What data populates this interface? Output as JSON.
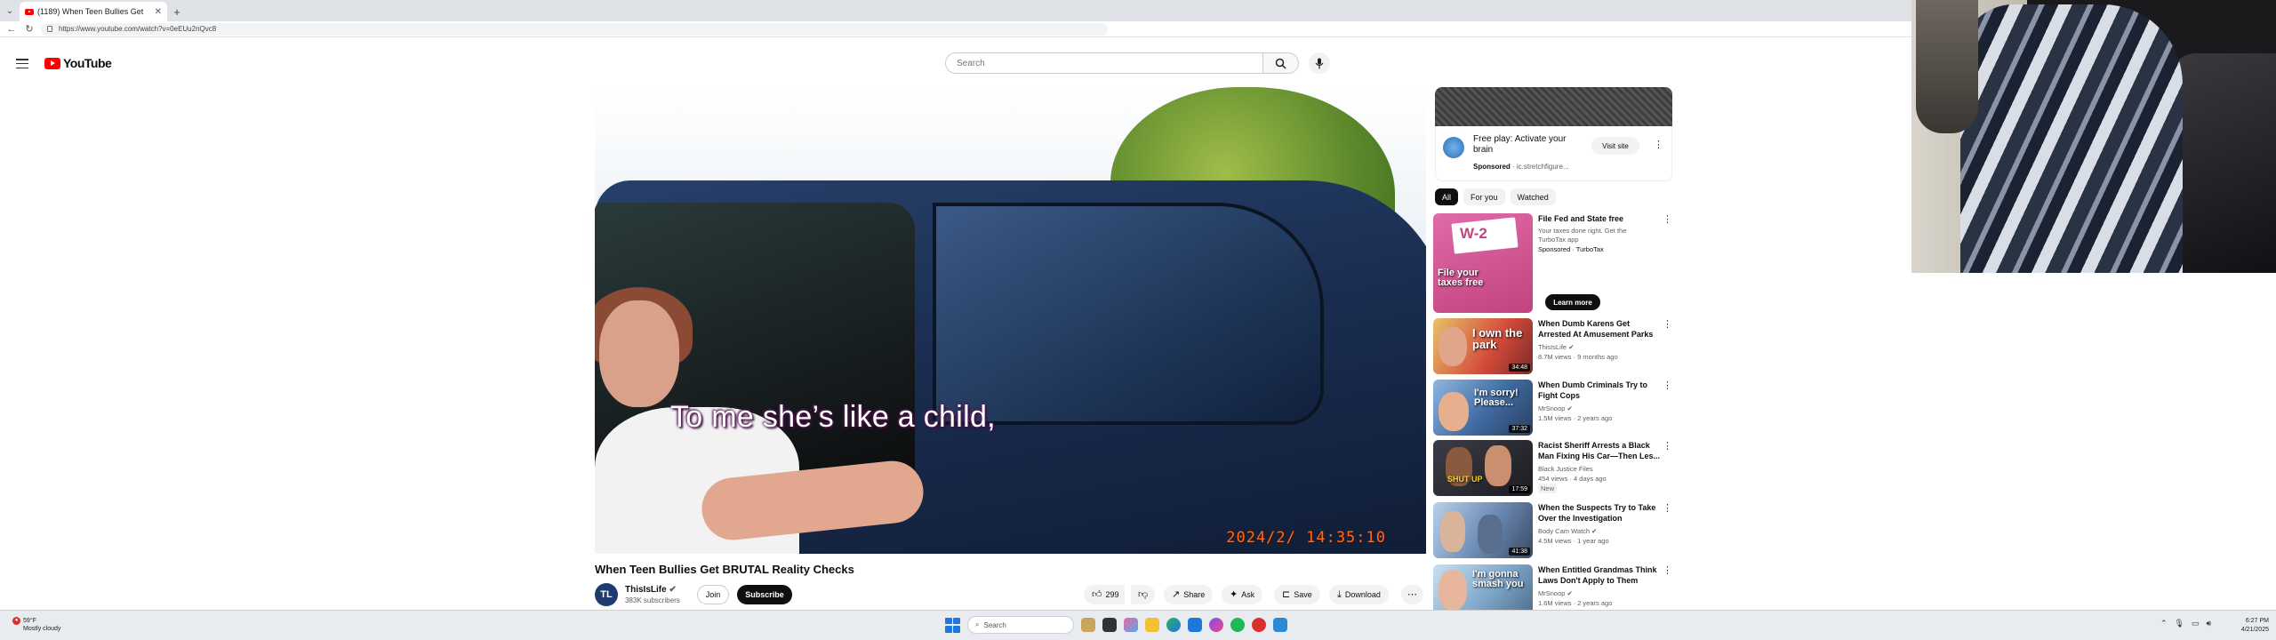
{
  "browser": {
    "tab_title": "(1189) When Teen Bullies Get",
    "url": "https://www.youtube.com/watch?v=0eEUu2nQvc8"
  },
  "header": {
    "logo_text": "YouTube",
    "search_placeholder": "Search"
  },
  "video": {
    "caption": "To me she’s like a child,",
    "timestamp": "2024/2/ 14:35:10",
    "title": "When Teen Bullies Get BRUTAL Reality Checks",
    "channel_name": "ThisIsLife",
    "channel_avatar_text": "TL",
    "subscribers": "383K subscribers",
    "join_label": "Join",
    "subscribe_label": "Subscribe",
    "likes": "299",
    "share_label": "Share",
    "ask_label": "Ask",
    "save_label": "Save",
    "download_label": "Download"
  },
  "ad": {
    "title": "Free play: Activate your brain",
    "sponsored": "Sponsored",
    "domain": "· ic.stretchfigure...",
    "visit_label": "Visit site"
  },
  "chips": [
    "All",
    "For you",
    "Watched"
  ],
  "recommendations": [
    {
      "title": "File Fed and State free",
      "meta1": "Your taxes done right. Get the",
      "meta2": "TurboTax app",
      "meta3": "Sponsored · TurboTax",
      "thumb_text": "W-2",
      "thumb_text2": "File your taxes free",
      "button": "Learn more"
    },
    {
      "title": "When Dumb Karens Get Arrested At Amusement Parks",
      "meta1": "ThisIsLife",
      "meta2": "8.7M views · 9 months ago",
      "thumb_text": "I own the park",
      "duration": "34:48"
    },
    {
      "title": "When Dumb Criminals Try to Fight Cops",
      "meta1": "MrSnoop",
      "meta2": "1.5M views · 2 years ago",
      "thumb_text": "I'm sorry! Please...",
      "duration": "37:32"
    },
    {
      "title": "Racist Sheriff Arrests a Black Man Fixing His Car—Then Les...",
      "meta1": "Black Justice Files",
      "meta2": "454 views · 4 days ago",
      "meta3": "New",
      "thumb_text": "SHUT UP",
      "duration": "17:59"
    },
    {
      "title": "When the Suspects Try to Take Over the Investigation",
      "meta1": "Body Cam Watch",
      "meta2": "4.5M views · 1 year ago",
      "duration": "41:38"
    },
    {
      "title": "When Entitled Grandmas Think Laws Don't Apply to Them",
      "meta1": "MrSnoop",
      "meta2": "1.6M views · 2 years ago",
      "thumb_text": "I'm gonna smash you"
    }
  ],
  "taskbar": {
    "weather_temp": "59°F",
    "weather_text": "Mostly cloudy",
    "search_label": "Search",
    "time": "6:27 PM",
    "date": "4/21/2025"
  }
}
